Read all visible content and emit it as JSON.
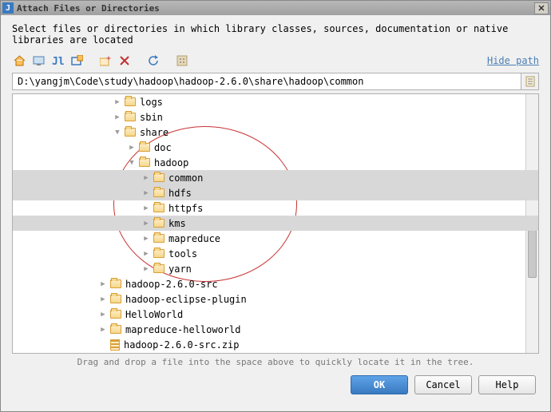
{
  "window": {
    "title": "Attach Files or Directories"
  },
  "instruction": "Select files or directories in which library classes, sources, documentation or native libraries are located",
  "toolbar": {
    "hide_path": "Hide path"
  },
  "path": {
    "value": "D:\\yangjm\\Code\\study\\hadoop\\hadoop-2.6.0\\share\\hadoop\\common"
  },
  "tree": {
    "items": [
      {
        "depth": 7,
        "expander": "right",
        "icon": "folder",
        "label": "logs"
      },
      {
        "depth": 7,
        "expander": "right",
        "icon": "folder",
        "label": "sbin"
      },
      {
        "depth": 7,
        "expander": "down",
        "icon": "folder",
        "label": "share"
      },
      {
        "depth": 8,
        "expander": "right",
        "icon": "folder",
        "label": "doc"
      },
      {
        "depth": 8,
        "expander": "down",
        "icon": "folder",
        "label": "hadoop"
      },
      {
        "depth": 9,
        "expander": "right",
        "icon": "folder",
        "label": "common",
        "selected": true
      },
      {
        "depth": 9,
        "expander": "right",
        "icon": "folder",
        "label": "hdfs",
        "selected": true
      },
      {
        "depth": 9,
        "expander": "right",
        "icon": "folder",
        "label": "httpfs"
      },
      {
        "depth": 9,
        "expander": "right",
        "icon": "folder",
        "label": "kms",
        "selected": true
      },
      {
        "depth": 9,
        "expander": "right",
        "icon": "folder",
        "label": "mapreduce"
      },
      {
        "depth": 9,
        "expander": "right",
        "icon": "folder",
        "label": "tools"
      },
      {
        "depth": 9,
        "expander": "right",
        "icon": "folder",
        "label": "yarn"
      },
      {
        "depth": 6,
        "expander": "right",
        "icon": "folder",
        "label": "hadoop-2.6.0-src"
      },
      {
        "depth": 6,
        "expander": "right",
        "icon": "folder",
        "label": "hadoop-eclipse-plugin"
      },
      {
        "depth": 6,
        "expander": "right",
        "icon": "folder",
        "label": "HelloWorld"
      },
      {
        "depth": 6,
        "expander": "right",
        "icon": "folder",
        "label": "mapreduce-helloworld"
      },
      {
        "depth": 6,
        "expander": "none",
        "icon": "zip",
        "label": "hadoop-2.6.0-src.zip"
      }
    ]
  },
  "hint": "Drag and drop a file into the space above to quickly locate it in the tree.",
  "buttons": {
    "ok": "OK",
    "cancel": "Cancel",
    "help": "Help"
  }
}
